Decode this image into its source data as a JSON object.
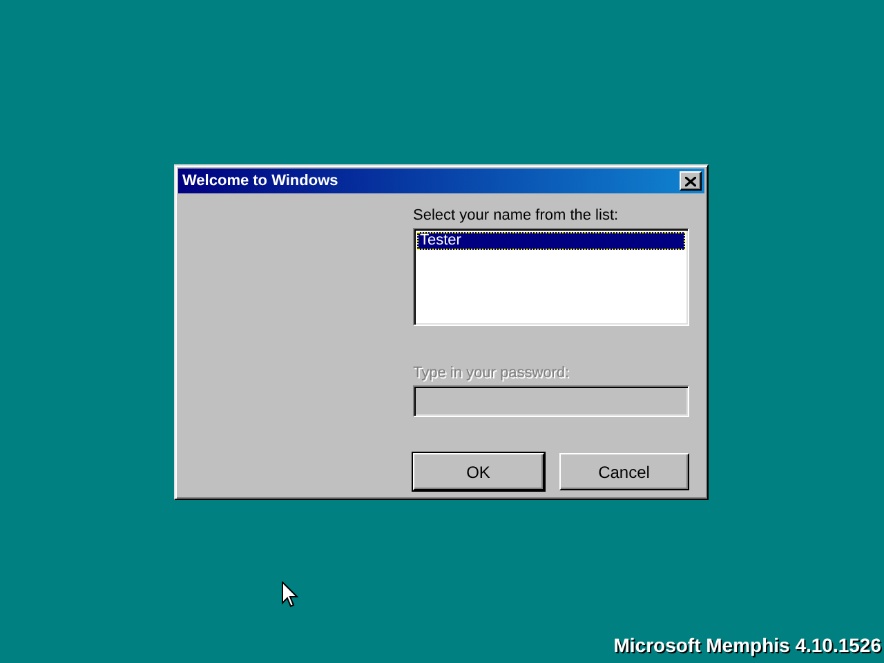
{
  "window": {
    "title": "Welcome to Windows"
  },
  "user_list": {
    "label": "Select your name from the list:",
    "items": [
      {
        "label": "Tester",
        "selected": true
      }
    ]
  },
  "password": {
    "label": "Type in your password:",
    "disabled": true
  },
  "buttons": [
    {
      "label": "OK",
      "default": true
    },
    {
      "label": "Cancel",
      "default": false
    }
  ],
  "desktop": {
    "version": "Microsoft Memphis 4.10.1526"
  }
}
